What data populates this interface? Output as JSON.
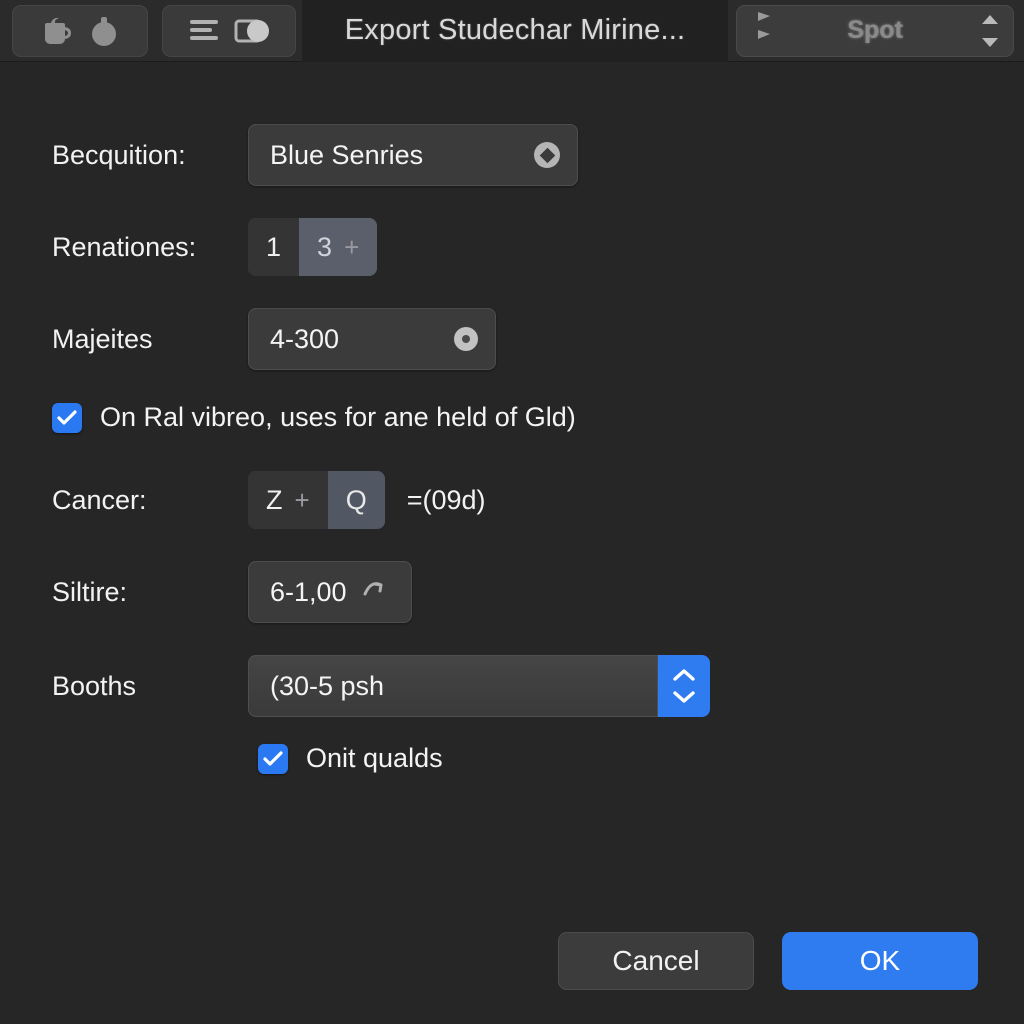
{
  "titlebar": {
    "title": "Export Studechar Mirine...",
    "tool_group_1": {
      "icon_a": "pitcher-icon",
      "icon_b": "balloon-icon"
    },
    "tool_group_2": {
      "icon_a": "list-lines-icon",
      "icon_b": "contrast-toggle-icon"
    },
    "right_stepper": {
      "label": "Spot",
      "left_icon": "flag-marker-icon",
      "up_arrow": "caret-up-icon",
      "down_arrow": "caret-down-icon"
    }
  },
  "form": {
    "rows": [
      {
        "label": "Becquition:",
        "value": "Blue Senries",
        "control": "dropdown",
        "indicator_icon": "disclosure-diamond-icon"
      },
      {
        "label": "Renationes:",
        "control": "segmented",
        "segments": [
          {
            "text": "1",
            "selected": false
          },
          {
            "text": "3",
            "glyph": "+",
            "selected": true
          }
        ]
      },
      {
        "label": "Majeites",
        "value": "4-300",
        "control": "dropdown",
        "indicator_icon": "radio-dot-icon"
      },
      {
        "label": "Cancer:",
        "control": "segmented",
        "suffix": "=(09d)",
        "segments": [
          {
            "text": "Z",
            "glyph": "+",
            "selected": false
          },
          {
            "text": "Q",
            "selected": true
          }
        ]
      },
      {
        "label": "Siltire:",
        "value": "6-1,00",
        "control": "dropdown",
        "indicator_icon": "curved-arrow-icon"
      },
      {
        "label": "Booths",
        "value": "(30-5 psh",
        "control": "textfield-stepper",
        "stepper_up_icon": "chevron-up-icon",
        "stepper_down_icon": "chevron-down-icon"
      }
    ],
    "checkboxes": [
      {
        "label": "On Ral vibreo, uses for ane held of Gld)",
        "checked": true
      },
      {
        "label": "Onit qualds",
        "checked": true
      }
    ]
  },
  "buttons": {
    "cancel": "Cancel",
    "ok": "OK"
  },
  "colors": {
    "background": "#262626",
    "accent_blue": "#2f7bf0",
    "checkbox_blue": "#2a79f3",
    "panel": "#3b3b3b",
    "segment_selected": "#5a5f6b",
    "text": "#f2f2f2"
  }
}
